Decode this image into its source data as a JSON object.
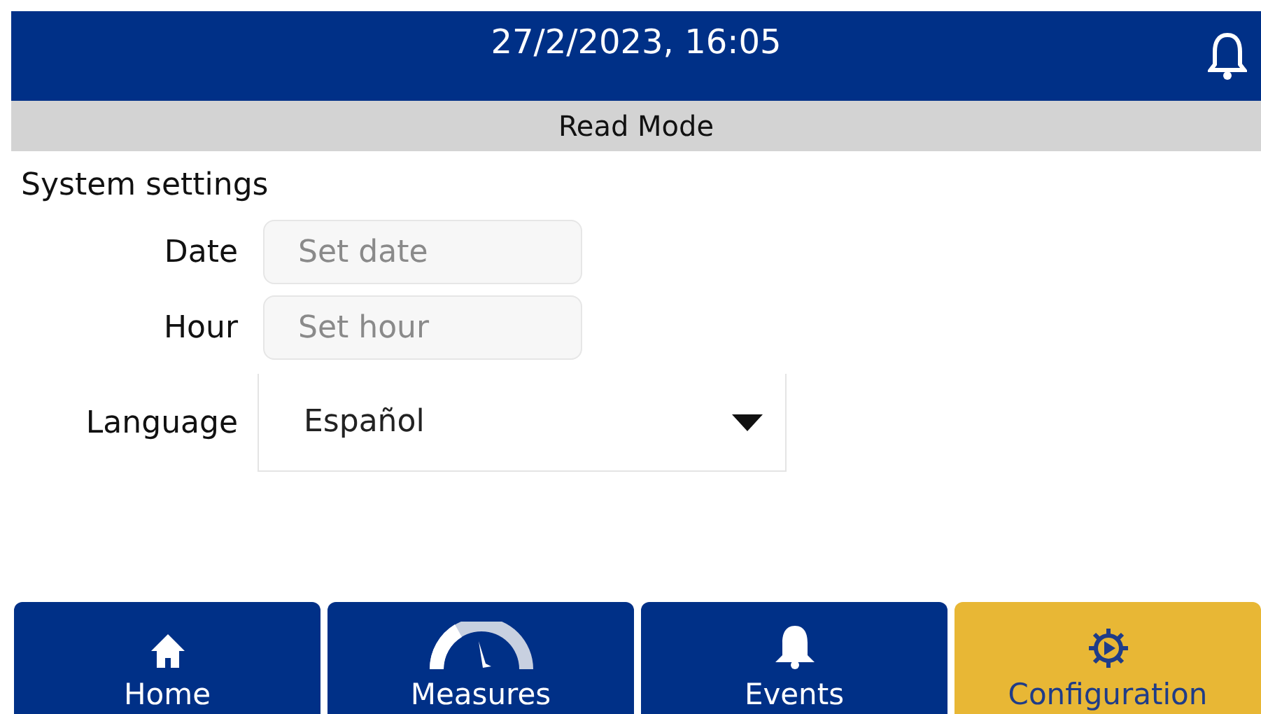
{
  "header": {
    "datetime": "27/2/2023, 16:05"
  },
  "mode_bar": {
    "text": "Read Mode"
  },
  "section_title": "System settings",
  "fields": [
    {
      "kind": "input",
      "label": "Date",
      "placeholder": "Set date"
    },
    {
      "kind": "input",
      "label": "Hour",
      "placeholder": "Set hour"
    },
    {
      "kind": "select",
      "label": "Language",
      "value": "Español"
    }
  ],
  "tabs": [
    {
      "kind": "home",
      "label": "Home",
      "selected": false
    },
    {
      "kind": "measures",
      "label": "Measures",
      "selected": false
    },
    {
      "kind": "events",
      "label": "Events",
      "selected": false
    },
    {
      "kind": "configuration",
      "label": "Configuration",
      "selected": true
    }
  ]
}
